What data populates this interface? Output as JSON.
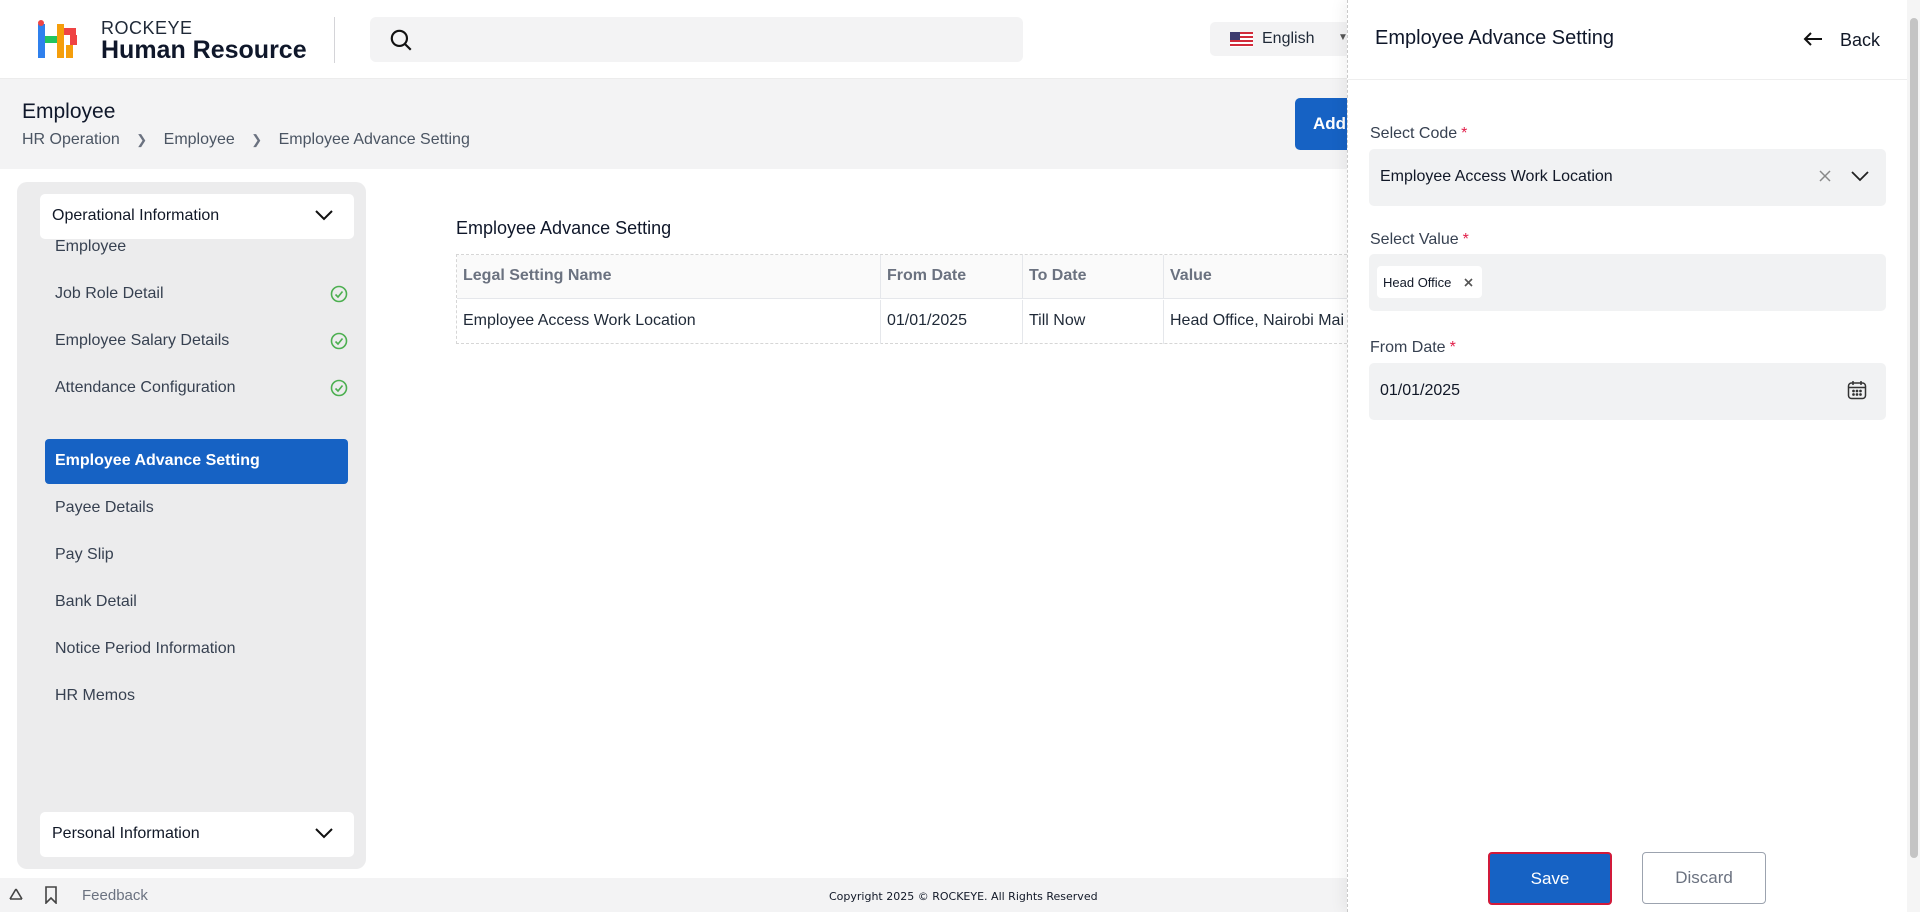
{
  "header": {
    "brand_top": "ROCKEYE",
    "brand_bottom": "Human Resource",
    "language": "English"
  },
  "page": {
    "title": "Employee",
    "breadcrumb": [
      "HR Operation",
      "Employee",
      "Employee Advance Setting"
    ],
    "add_button_label": "Add"
  },
  "sidebar": {
    "section_top": "Operational Information",
    "items": [
      {
        "label": "Employee",
        "checked": false,
        "active": false
      },
      {
        "label": "Job Role Detail",
        "checked": true,
        "active": false
      },
      {
        "label": "Employee Salary Details",
        "checked": true,
        "active": false
      },
      {
        "label": "Attendance Configuration",
        "checked": true,
        "active": false
      },
      {
        "label": "Employee Advance Setting",
        "checked": false,
        "active": true
      },
      {
        "label": "Payee Details",
        "checked": false,
        "active": false
      },
      {
        "label": "Pay Slip",
        "checked": false,
        "active": false
      },
      {
        "label": "Bank Detail",
        "checked": false,
        "active": false
      },
      {
        "label": "Notice Period Information",
        "checked": false,
        "active": false
      },
      {
        "label": "HR Memos",
        "checked": false,
        "active": false
      }
    ],
    "section_bottom": "Personal Information"
  },
  "table": {
    "title": "Employee Advance Setting",
    "columns": [
      "Legal Setting Name",
      "From Date",
      "To Date",
      "Value"
    ],
    "rows": [
      [
        "Employee Access Work Location",
        "01/01/2025",
        "Till Now",
        "Head Office, Nairobi Mai"
      ]
    ]
  },
  "footer": {
    "feedback": "Feedback",
    "copyright": "Copyright 2025 © ROCKEYE. All Rights Reserved"
  },
  "drawer": {
    "title": "Employee Advance Setting",
    "back_label": "Back",
    "select_code_label": "Select Code",
    "select_code_value": "Employee Access Work Location",
    "select_value_label": "Select Value",
    "select_value_tags": [
      "Head Office"
    ],
    "from_date_label": "From Date",
    "from_date_value": "01/01/2025",
    "required_mark": "*",
    "save_label": "Save",
    "discard_label": "Discard"
  },
  "colors": {
    "primary": "#1662c4",
    "check_green": "#4caf50",
    "required_red": "#e11d48",
    "save_border": "#d11a3a"
  }
}
